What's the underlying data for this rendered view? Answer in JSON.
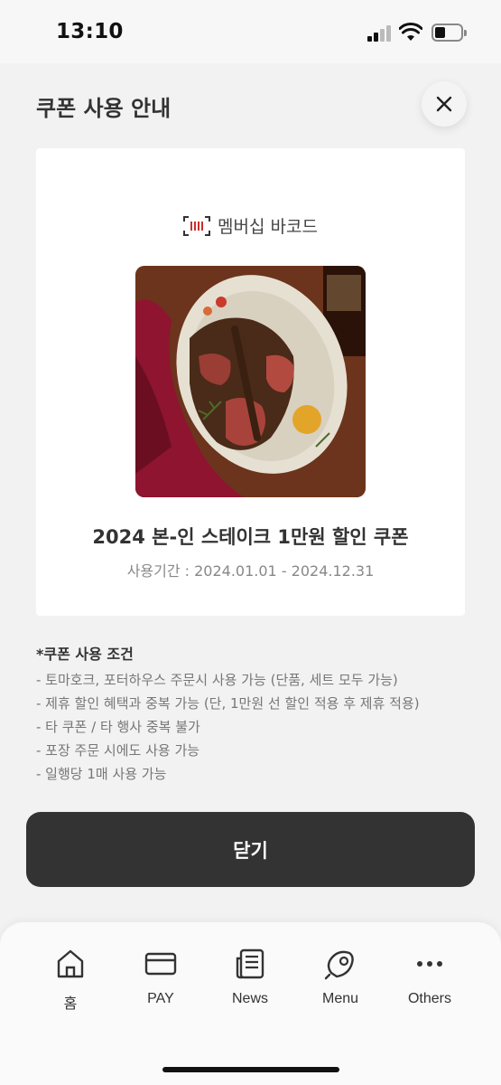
{
  "status_bar": {
    "time": "13:10"
  },
  "header": {
    "title": "쿠폰 사용 안내",
    "close_icon": "close-icon"
  },
  "coupon": {
    "barcode_label": "멤버십 바코드",
    "image_alt": "steak-photo",
    "title": "2024 본-인 스테이크 1만원 할인 쿠폰",
    "period": "사용기간 : 2024.01.01 - 2024.12.31"
  },
  "terms": {
    "title": "*쿠폰 사용 조건",
    "items": [
      "- 토마호크, 포터하우스 주문시 사용 가능 (단품, 세트 모두 가능)",
      "- 제휴 할인 혜택과 중복 가능 (단, 1만원 선 할인 적용 후 제휴 적용)",
      "- 타 쿠폰 / 타 행사 중복 불가",
      "- 포장 주문 시에도 사용 가능",
      "- 일행당 1매 사용 가능"
    ]
  },
  "close_button": {
    "label": "닫기"
  },
  "tab_bar": {
    "tabs": [
      {
        "label": "홈",
        "icon": "home-icon"
      },
      {
        "label": "PAY",
        "icon": "card-icon"
      },
      {
        "label": "News",
        "icon": "news-icon"
      },
      {
        "label": "Menu",
        "icon": "meat-icon"
      },
      {
        "label": "Others",
        "icon": "more-icon"
      }
    ]
  },
  "colors": {
    "button": "#333333",
    "background": "#f2f2f2",
    "card": "#ffffff",
    "barcode_accent": "#c9302c"
  }
}
